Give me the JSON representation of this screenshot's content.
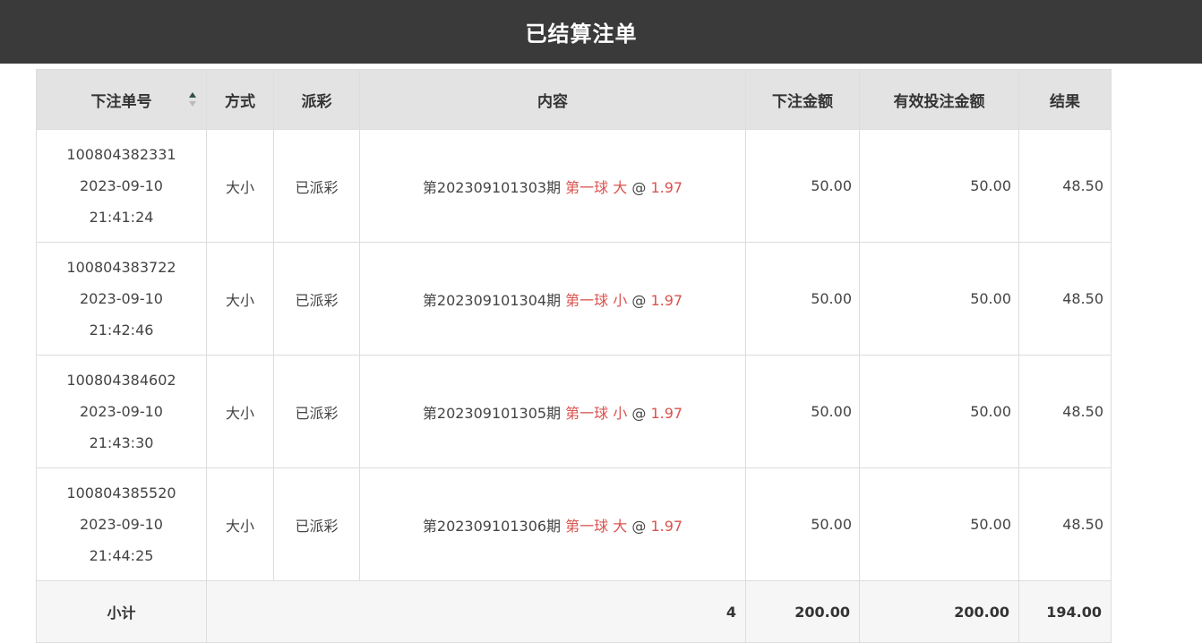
{
  "page": {
    "title": "已结算注单"
  },
  "colors": {
    "header_bg": "#3a3a3a",
    "table_header_bg": "#e3e3e3",
    "accent_red": "#d9534f"
  },
  "table": {
    "headers": {
      "order_no": "下注单号",
      "method": "方式",
      "payout": "派彩",
      "content": "内容",
      "bet_amount": "下注金额",
      "valid_amount": "有效投注金额",
      "result": "结果"
    },
    "sort_icon": "sort-ascending-icon",
    "rows": [
      {
        "order_no": "100804382331",
        "date": "2023-09-10",
        "time": "21:41:24",
        "method": "大小",
        "payout": "已派彩",
        "period": "第202309101303期",
        "ball": "第一球",
        "pick": "大",
        "at": "@",
        "odds": "1.97",
        "bet_amount": "50.00",
        "valid_amount": "50.00",
        "result": "48.50"
      },
      {
        "order_no": "100804383722",
        "date": "2023-09-10",
        "time": "21:42:46",
        "method": "大小",
        "payout": "已派彩",
        "period": "第202309101304期",
        "ball": "第一球",
        "pick": "小",
        "at": "@",
        "odds": "1.97",
        "bet_amount": "50.00",
        "valid_amount": "50.00",
        "result": "48.50"
      },
      {
        "order_no": "100804384602",
        "date": "2023-09-10",
        "time": "21:43:30",
        "method": "大小",
        "payout": "已派彩",
        "period": "第202309101305期",
        "ball": "第一球",
        "pick": "小",
        "at": "@",
        "odds": "1.97",
        "bet_amount": "50.00",
        "valid_amount": "50.00",
        "result": "48.50"
      },
      {
        "order_no": "100804385520",
        "date": "2023-09-10",
        "time": "21:44:25",
        "method": "大小",
        "payout": "已派彩",
        "period": "第202309101306期",
        "ball": "第一球",
        "pick": "大",
        "at": "@",
        "odds": "1.97",
        "bet_amount": "50.00",
        "valid_amount": "50.00",
        "result": "48.50"
      }
    ],
    "subtotal": {
      "label": "小计",
      "count": "4",
      "bet_amount": "200.00",
      "valid_amount": "200.00",
      "result": "194.00"
    }
  }
}
